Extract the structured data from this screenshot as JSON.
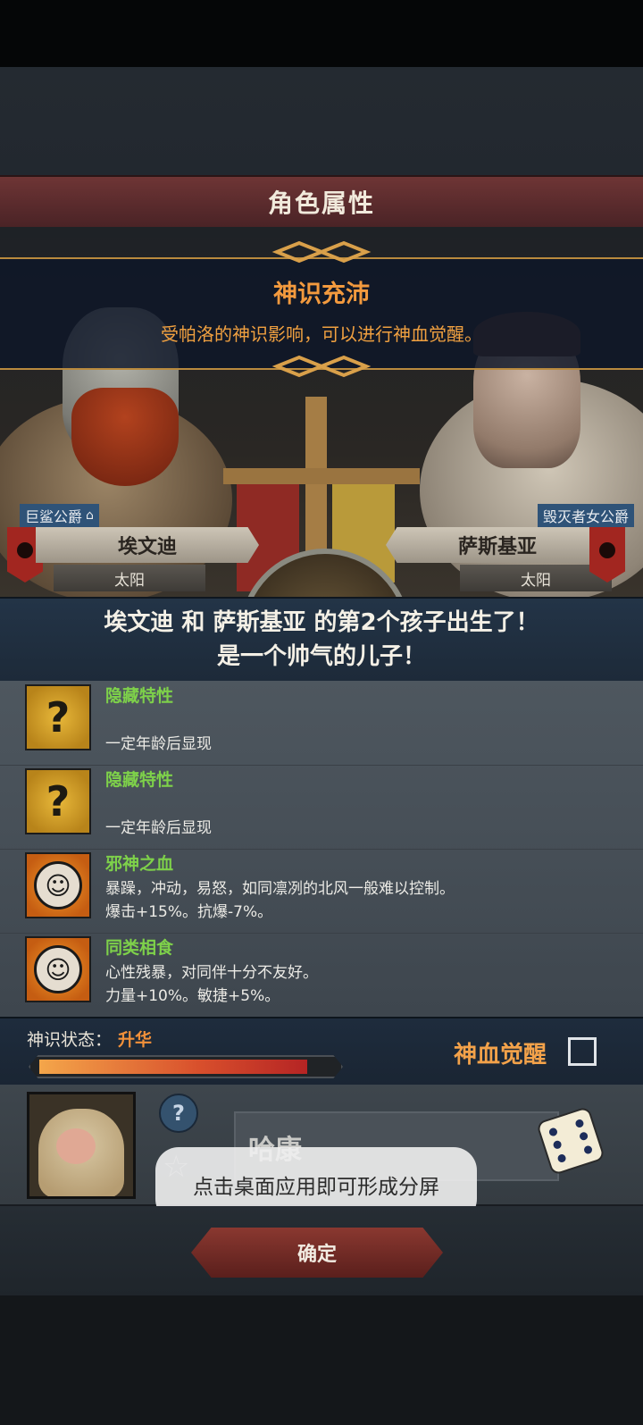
{
  "header": {
    "title": "角色属性"
  },
  "god_sense_banner": {
    "title": "神识充沛",
    "description": "受帕洛的神识影响，可以进行神血觉醒。"
  },
  "parents": {
    "left": {
      "title": "巨鲨公爵",
      "name": "埃文迪",
      "sign": "太阳"
    },
    "right": {
      "title": "毁灭者女公爵",
      "name": "萨斯基亚",
      "sign": "太阳"
    }
  },
  "birth_message": {
    "line1": "埃文迪 和 萨斯基亚 的第2个孩子出生了！",
    "line2": "是一个帅气的儿子！"
  },
  "traits": [
    {
      "name": "隐藏特性",
      "desc1": "",
      "desc2": "一定年龄后显现",
      "icon": "question-icon"
    },
    {
      "name": "隐藏特性",
      "desc1": "",
      "desc2": "一定年龄后显现",
      "icon": "question-icon"
    },
    {
      "name": "邪神之血",
      "desc1": "暴躁，冲动，易怒，如同凛冽的北风一般难以控制。",
      "desc2": "爆击+15%。抗爆-7%。",
      "icon": "smiling-sun-icon"
    },
    {
      "name": "同类相食",
      "desc1": "心性残暴，对同伴十分不友好。",
      "desc2": "力量+10%。敏捷+5%。",
      "icon": "smiling-sun-icon"
    }
  ],
  "status": {
    "label": "神识状态：",
    "value": "升华",
    "progress": 0.92,
    "awaken_label": "神血觉醒",
    "awaken_checked": false
  },
  "child": {
    "name": "哈康"
  },
  "toast": {
    "text": "点击桌面应用即可形成分屏"
  },
  "footer": {
    "confirm_label": "确定"
  },
  "colors": {
    "accent_orange": "#f39a3e",
    "trait_green": "#7ed14a",
    "header_red": "#6e3535",
    "panel_blue": "#233447"
  }
}
